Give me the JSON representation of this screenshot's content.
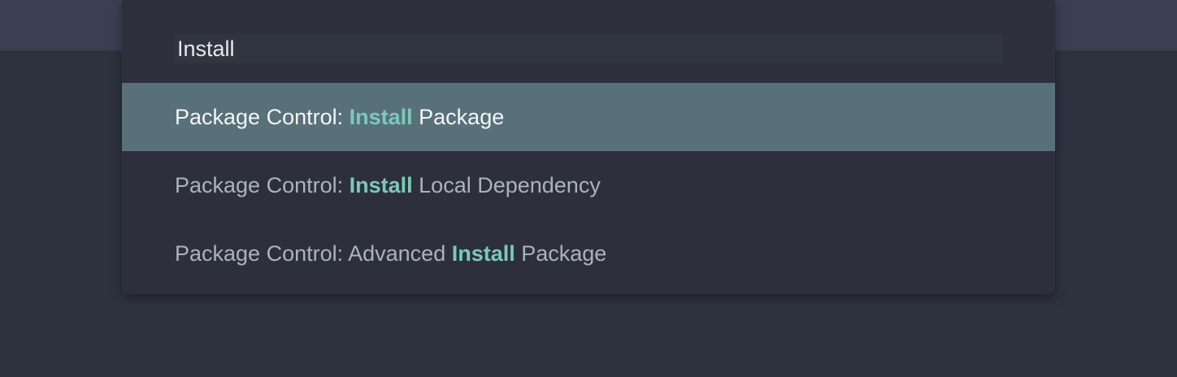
{
  "colors": {
    "background": "#2d323e",
    "top_bar": "#3a4052",
    "palette": "#2d303c",
    "selected_row": "#587079",
    "match_highlight": "#7ac9bb"
  },
  "palette": {
    "query": "Install",
    "results": [
      {
        "before": "Package Control: ",
        "match": "Install",
        "after": " Package",
        "selected": true
      },
      {
        "before": "Package Control: ",
        "match": "Install",
        "after": " Local Dependency",
        "selected": false
      },
      {
        "before": "Package Control: Advanced ",
        "match": "Install",
        "after": " Package",
        "selected": false
      }
    ]
  }
}
